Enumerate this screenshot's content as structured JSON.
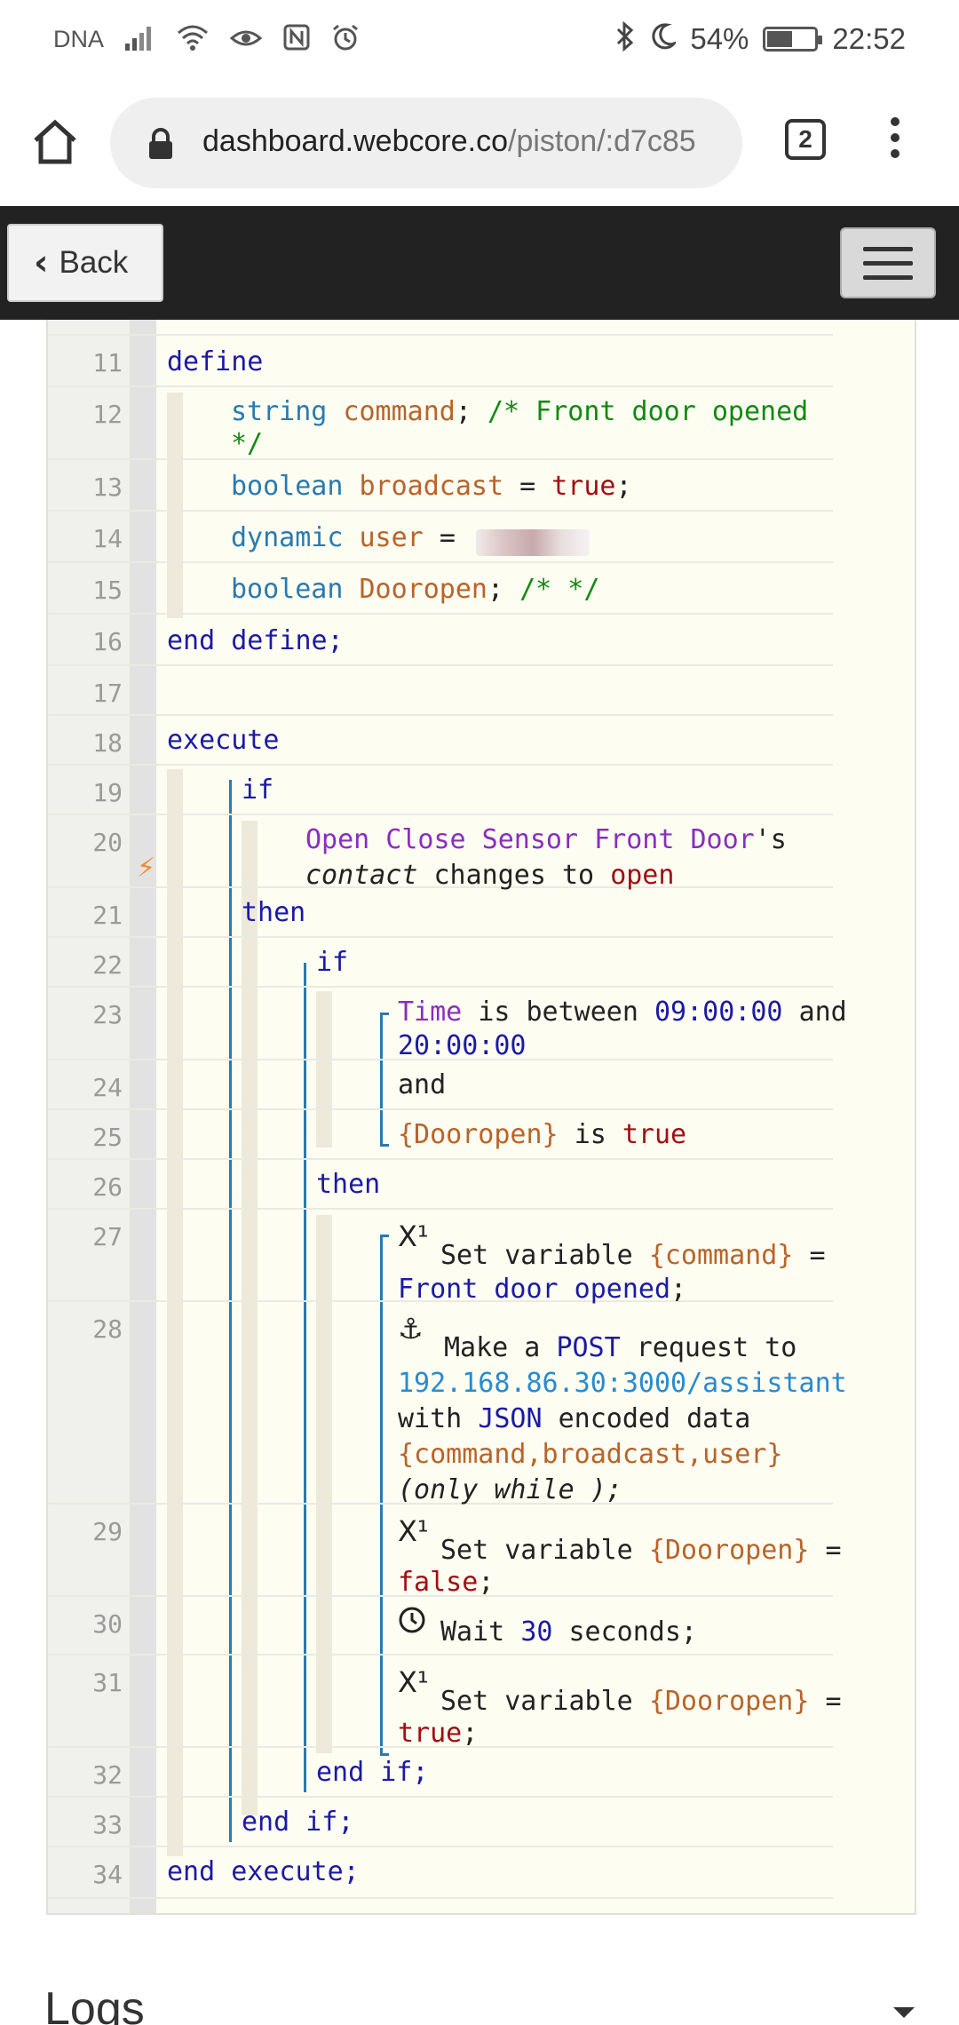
{
  "status_bar": {
    "carrier": "DNA",
    "battery_percent": "54%",
    "battery_level": 0.54,
    "time": "22:52",
    "icons": [
      "signal-icon",
      "wifi-icon",
      "eye-icon",
      "nfc-icon",
      "alarm-icon",
      "bluetooth-icon",
      "moon-icon",
      "battery-icon"
    ]
  },
  "browser": {
    "url_host": "dashboard.webcore.co",
    "url_path": "/piston/:d7c85",
    "tab_count": "2"
  },
  "app_header": {
    "back_label": "Back"
  },
  "code_lines": {
    "l11": "11",
    "l12": "12",
    "l13": "13",
    "l14": "14",
    "l15": "15",
    "l16": "16",
    "l17": "17",
    "l18": "18",
    "l19": "19",
    "l20": "20",
    "l21": "21",
    "l22": "22",
    "l23": "23",
    "l24": "24",
    "l25": "25",
    "l26": "26",
    "l27": "27",
    "l28": "28",
    "l29": "29",
    "l30": "30",
    "l31": "31",
    "l32": "32",
    "l33": "33",
    "l34": "34"
  },
  "code": {
    "define": "define",
    "string": "string",
    "command": "command",
    "cmt_front": "/* Front door opened",
    "cmt_end": "*/",
    "boolean": "boolean",
    "broadcast": "broadcast",
    "eq": "=",
    "true": "true",
    "semi": ";",
    "dynamic": "dynamic",
    "user": "user",
    "dooropen": "Dooropen",
    "cmt_empty": "/* */",
    "end_define": "end define;",
    "execute": "execute",
    "if": "if",
    "device": "Open Close Sensor Front Door",
    "possessive": "'s",
    "contact": "contact",
    "changes_to": "changes to",
    "open": "open",
    "then": "then",
    "time": "Time",
    "is_between": "is between",
    "t1": "09:00:00",
    "and": "and",
    "t2": "20:00:00",
    "dooropen_var": "{Dooropen}",
    "is": "is",
    "set_variable": "Set variable",
    "command_var": "{command}",
    "front_door_opened": "Front door opened",
    "make_a": "Make a",
    "post": "POST",
    "request_to": "request to",
    "endpoint": "192.168.86.30:3000/assistant",
    "with": "with",
    "json": "JSON",
    "encoded_data": "encoded data",
    "payload": "{command,broadcast,user}",
    "only_while": "(only while );",
    "false": "false",
    "wait": "Wait",
    "wait_n": "30",
    "seconds": "seconds;",
    "end_if": "end if;",
    "end_execute": "end execute;"
  },
  "logs": {
    "title": "Logs"
  }
}
